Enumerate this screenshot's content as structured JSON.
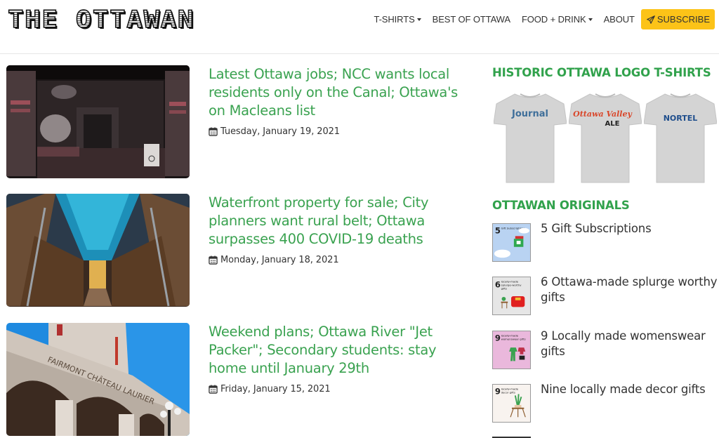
{
  "header": {
    "logo_text": "THE OTTAWAN",
    "nav": [
      {
        "label": "T-SHIRTS",
        "dropdown": true
      },
      {
        "label": "BEST OF OTTAWA",
        "dropdown": false
      },
      {
        "label": "FOOD + DRINK",
        "dropdown": true
      },
      {
        "label": "ABOUT",
        "dropdown": false
      }
    ],
    "subscribe_label": "SUBSCRIBE",
    "subscribe_icon": "paper-plane-icon",
    "subscribe_color": "#fcc318"
  },
  "articles": [
    {
      "title": "Latest Ottawa jobs; NCC wants local residents only on the Canal; Ottawa's on Macleans list",
      "date": "Tuesday, January 19, 2021",
      "image": "dark restaurant entrance interior"
    },
    {
      "title": "Waterfront property for sale; City planners want rural belt; Ottawa surpasses 400 COVID-19 deaths",
      "date": "Monday, January 18, 2021",
      "image": "cathedral interior with blue vaulted ceiling"
    },
    {
      "title": "Weekend plans; Ottawa River \"Jet Packer\"; Secondary students: stay home until January 29th",
      "date": "Friday, January 15, 2021",
      "image": "Fairmont Chateau Laurier facade",
      "image_text": "FAIRMONT CHÂTEAU LAURIER"
    }
  ],
  "sidebar": {
    "tshirts_heading": "HISTORIC OTTAWA LOGO T-SHIRTS",
    "tshirts": [
      {
        "logo": "Journal",
        "color": "#3f6f9a"
      },
      {
        "logo": "Ottawa Valley ALE",
        "color": "#d9472b"
      },
      {
        "logo": "NORTEL",
        "color": "#1f4e8c"
      }
    ],
    "originals_heading": "OTTAWAN ORIGINALS",
    "originals": [
      {
        "label": "5 Gift Subscriptions",
        "thumb_number": "5",
        "thumb_caption": "Gift Subscriptions",
        "thumb_bg": "#b9d3f2"
      },
      {
        "label": "6 Ottawa-made splurge worthy gifts",
        "thumb_number": "6",
        "thumb_caption": "locally-made splurge-worthy gifts",
        "thumb_bg": "#e6e6e6"
      },
      {
        "label": "9 Locally made womenswear gifts",
        "thumb_number": "9",
        "thumb_caption": "locally-made womenswear gifts",
        "thumb_bg": "#eab8dc"
      },
      {
        "label": "Nine locally made decor gifts",
        "thumb_number": "9",
        "thumb_caption": "locally-made decor gifts",
        "thumb_bg": "#f8f3ef"
      }
    ]
  },
  "colors": {
    "accent_green": "#3aa250",
    "text": "#333333"
  }
}
